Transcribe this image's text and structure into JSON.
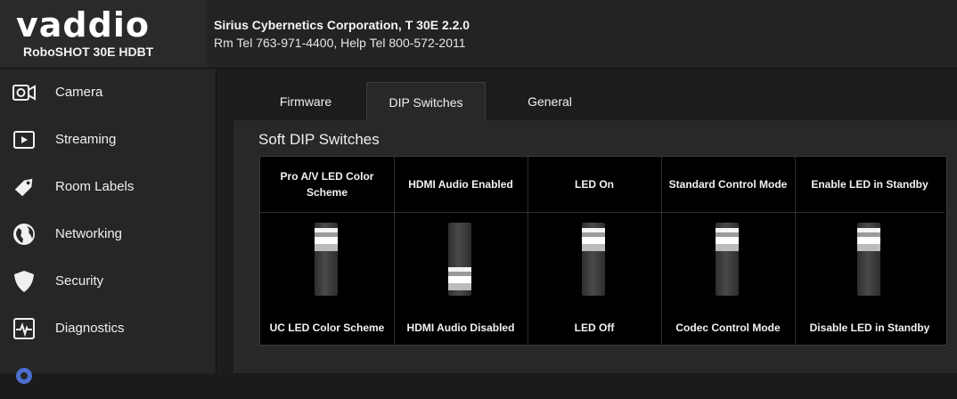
{
  "header": {
    "logo": "vaddio",
    "model": "RoboSHOT 30E HDBT",
    "company": "Sirius Cybernetics Corporation, T 30E 2.2.0",
    "phones": "Rm Tel 763-971-4400, Help Tel 800-572-2011"
  },
  "sidebar": {
    "items": [
      {
        "label": "Camera",
        "icon": "camera-icon"
      },
      {
        "label": "Streaming",
        "icon": "play-icon"
      },
      {
        "label": "Room Labels",
        "icon": "tag-icon"
      },
      {
        "label": "Networking",
        "icon": "globe-icon"
      },
      {
        "label": "Security",
        "icon": "shield-icon"
      },
      {
        "label": "Diagnostics",
        "icon": "pulse-icon"
      }
    ]
  },
  "tabs": [
    {
      "label": "Firmware",
      "active": false
    },
    {
      "label": "DIP Switches",
      "active": true
    },
    {
      "label": "General",
      "active": false
    }
  ],
  "panel": {
    "title": "Soft DIP Switches",
    "switches": [
      {
        "on_label": "Pro A/V LED Color Scheme",
        "off_label": "UC LED Color Scheme",
        "state": "up"
      },
      {
        "on_label": "HDMI Audio Enabled",
        "off_label": "HDMI Audio Disabled",
        "state": "down"
      },
      {
        "on_label": "LED On",
        "off_label": "LED Off",
        "state": "up"
      },
      {
        "on_label": "Standard Control Mode",
        "off_label": "Codec Control Mode",
        "state": "up"
      },
      {
        "on_label": "Enable LED in Standby",
        "off_label": "Disable LED in Standby",
        "state": "up"
      }
    ]
  },
  "colors": {
    "background": "#1b1b1b",
    "panel": "#282828",
    "text": "#f0f0f0"
  }
}
